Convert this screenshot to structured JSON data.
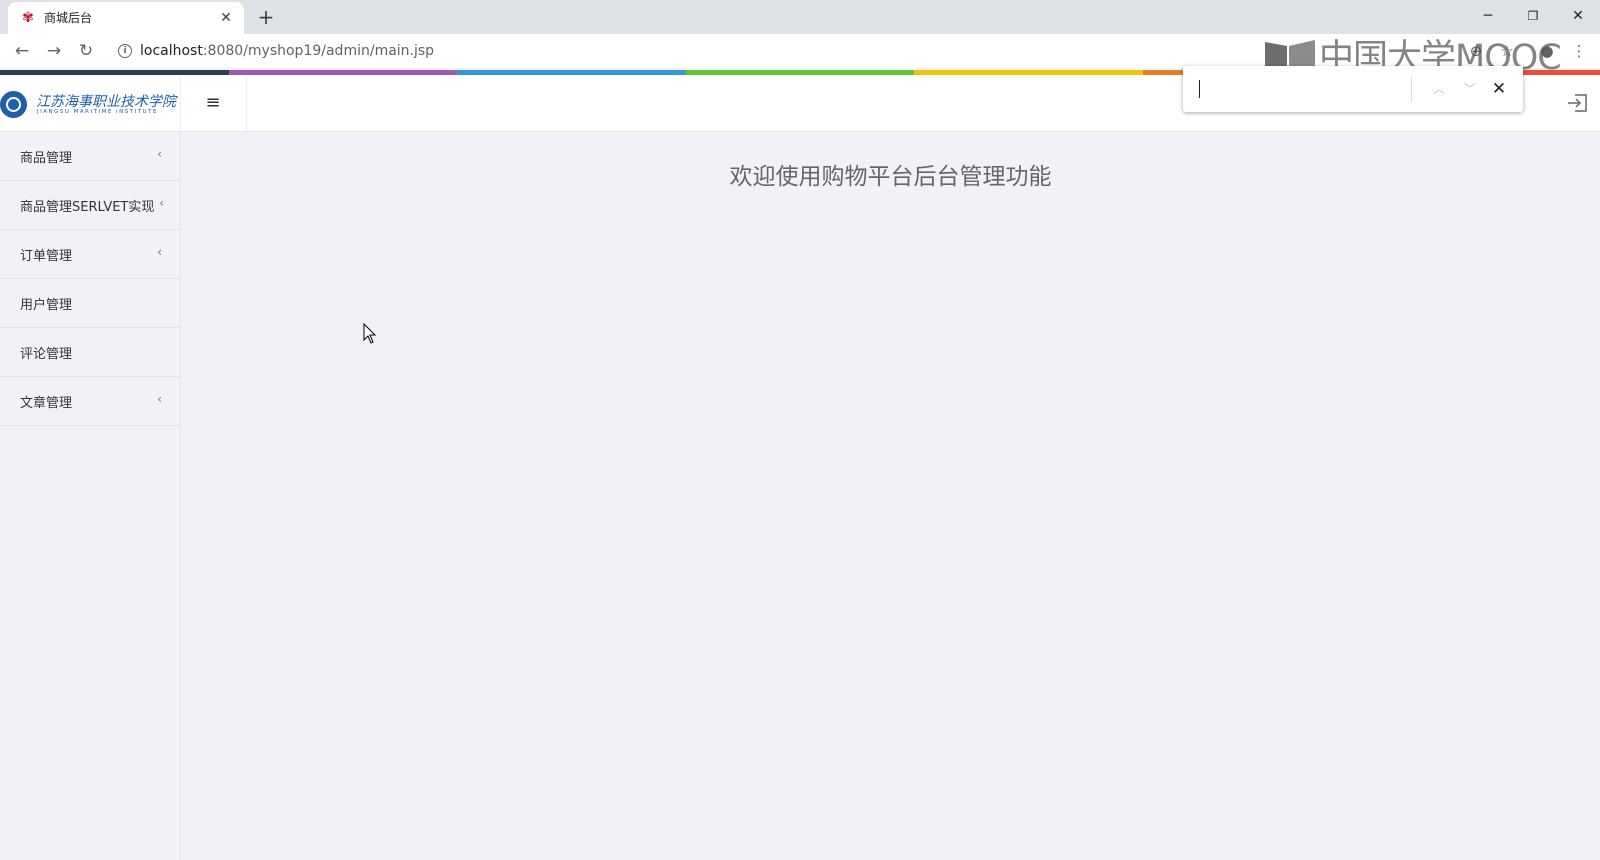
{
  "browser": {
    "tab": {
      "title": "商城后台",
      "favicon": "flower-favicon-icon"
    },
    "url": {
      "host": "localhost",
      "rest": ":8080/myshop19/admin/main.jsp"
    }
  },
  "watermark": {
    "text": "中国大学MOOC"
  },
  "rainbow": [
    "#2c3e50",
    "#9b59b6",
    "#3498db",
    "#67c23a",
    "#f1c40f",
    "#e67e22",
    "#e74c3c"
  ],
  "header": {
    "brand": {
      "name_cn": "江苏海事职业技术学院",
      "name_en": "JIANGSU MARITIME INSTITUTE"
    },
    "menu_toggle_icon": "hamburger-icon",
    "logout_icon": "logout-icon"
  },
  "find_bar": {
    "value": ""
  },
  "sidebar": {
    "items": [
      {
        "label": "商品管理",
        "has_caret": true
      },
      {
        "label": "商品管理SERLVET实现",
        "has_caret": true
      },
      {
        "label": "订单管理",
        "has_caret": true
      },
      {
        "label": "用户管理",
        "has_caret": false
      },
      {
        "label": "评论管理",
        "has_caret": false
      },
      {
        "label": "文章管理",
        "has_caret": true
      }
    ]
  },
  "main": {
    "welcome": "欢迎使用购物平台后台管理功能"
  }
}
